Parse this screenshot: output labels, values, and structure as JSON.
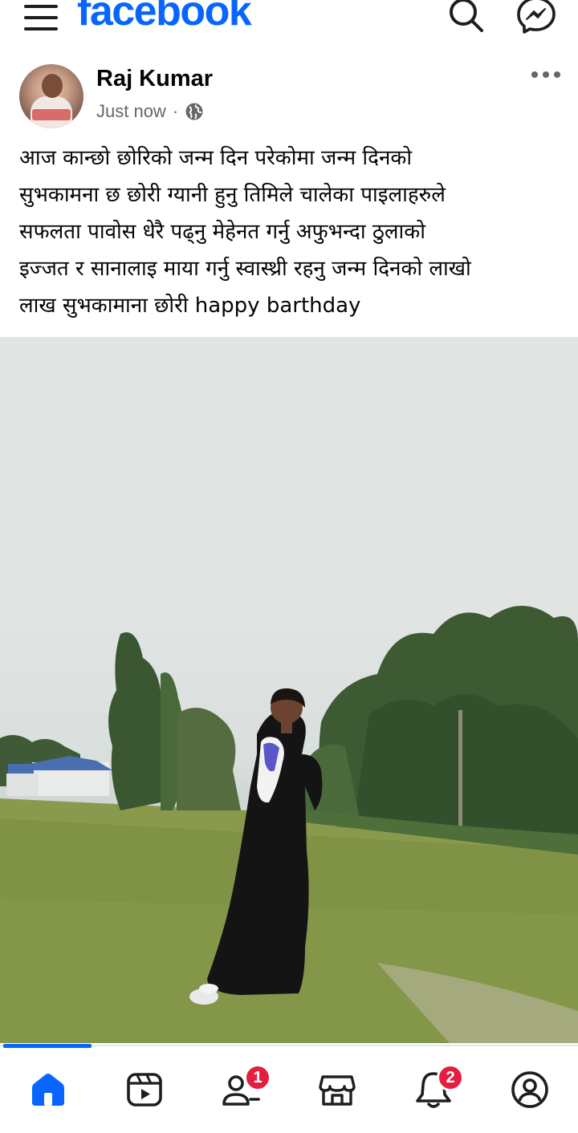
{
  "app": {
    "brand": "facebook",
    "accent_color": "#0866ff",
    "badge_color": "#e41e3f"
  },
  "topbar": {
    "icons": [
      "menu-icon",
      "search-icon",
      "messenger-icon"
    ]
  },
  "post": {
    "author": "Raj Kumar",
    "timestamp": "Just now",
    "separator": "·",
    "privacy_icon": "globe-icon",
    "lines": [
      "आज कान्छो छोरिको जन्म दिन परेकोमा जन्म दिनको",
      "सुभकामना छ छोरी ग्यानी हुनु तिमिले चालेका पाइलाहरुले",
      "सफलता पावोस धेरै पढ्नु मेहेनत गर्नु अफुभन्दा ठुलाको",
      "इज्जत र सानालाइ माया गर्नु स्वास्थ्री रहनु जन्म दिनको लाखो",
      "लाख सुभकामाना छोरी happy barthday"
    ]
  },
  "bottom_nav": {
    "items": [
      {
        "name": "home",
        "icon": "home-icon",
        "active": true,
        "badge": ""
      },
      {
        "name": "video",
        "icon": "video-icon",
        "active": false,
        "badge": ""
      },
      {
        "name": "friends",
        "icon": "friends-icon",
        "active": false,
        "badge": "1"
      },
      {
        "name": "marketplace",
        "icon": "marketplace-icon",
        "active": false,
        "badge": ""
      },
      {
        "name": "notifications",
        "icon": "bell-icon",
        "active": false,
        "badge": "2"
      },
      {
        "name": "profile",
        "icon": "profile-icon",
        "active": false,
        "badge": ""
      }
    ]
  }
}
